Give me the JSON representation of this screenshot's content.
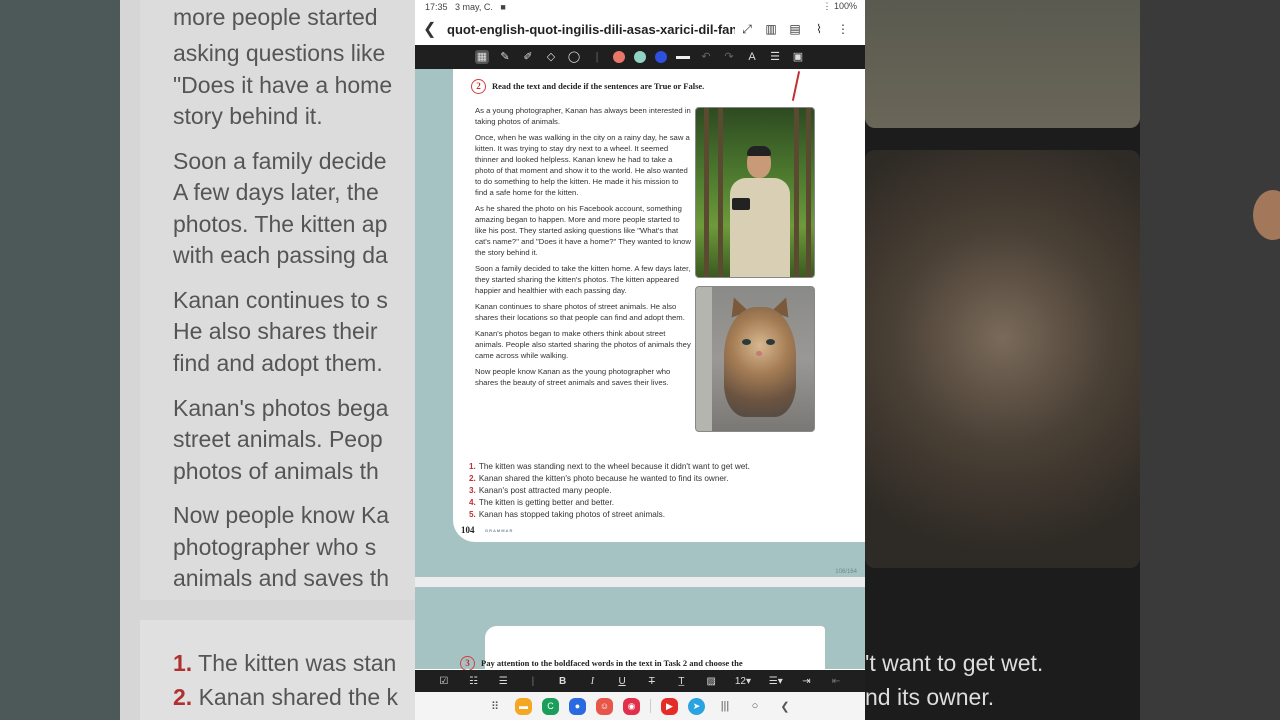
{
  "status": {
    "time": "17:35",
    "date": "3 may, C.",
    "battery": "100%"
  },
  "app": {
    "title": "quot-english-quot-ingilis-dili-asas-xarici-dil-fan",
    "back_icon": "arrow-left-icon",
    "toolbar_icons": [
      "expand-icon",
      "book-icon",
      "reader-icon",
      "attach-icon",
      "more-icon"
    ]
  },
  "pen_toolbar": {
    "tools": [
      "keyboard-icon",
      "pen-icon",
      "highlighter-icon",
      "eraser-icon",
      "lasso-icon"
    ],
    "colors": [
      "#e8776a",
      "#8fd3c2",
      "#2e4fe0"
    ]
  },
  "task": {
    "number": "2",
    "heading": "Read the text and decide if the sentences are True or False.",
    "paragraphs": [
      "As a young photographer, Kanan has always been interested in taking photos of animals.",
      "Once, when he was walking in the city on a rainy day, he saw a kitten. It was trying to stay dry next to a wheel. It seemed thinner and looked helpless. Kanan knew he had to take a photo of that moment and show it to the world. He also wanted to do something to help the kitten. He made it his mission to find a safe home for the kitten.",
      "As he shared the photo on his Facebook account, something amazing began to happen. More and more people started to like his post. They started asking questions like \"What's that cat's name?\" and \"Does it have a home?\" They wanted to know the story behind it.",
      "Soon a family decided to take the kitten home. A few days later, they started sharing the kitten's photos. The kitten appeared happier and healthier with each passing day.",
      "Kanan continues to share photos of street animals. He also shares their locations so that people can find and adopt them.",
      "Kanan's photos began to make others think about street animals. People also started sharing the photos of animals they came across while walking.",
      "Now people know Kanan as the young photographer who shares the beauty of street animals and saves their lives."
    ],
    "statements": [
      {
        "n": "1.",
        "text": "The kitten was standing next to the wheel because it didn't want to get wet."
      },
      {
        "n": "2.",
        "text": "Kanan shared the kitten's photo because he wanted to find its owner."
      },
      {
        "n": "3.",
        "text": "Kanan's post attracted many people."
      },
      {
        "n": "4.",
        "text": "The kitten is getting better and better."
      },
      {
        "n": "5.",
        "text": "Kanan has stopped taking photos of street animals."
      }
    ]
  },
  "page": {
    "number": "104",
    "label": "GRAMMAR",
    "count": "106/164"
  },
  "next_task": {
    "number": "3",
    "heading": "Pay attention to the boldfaced words in the text in Task 2 and choose the"
  },
  "format_toolbar": {
    "bold": "B",
    "italic": "I",
    "underline": "U",
    "strike": "T",
    "font_size": "12"
  },
  "background_left": {
    "lines": [
      "more people started",
      "asking questions like",
      "\"Does it have a home",
      "story behind it.",
      "Soon a family decide",
      "A few days later, the",
      "photos. The kitten ap",
      "with each passing da",
      "Kanan continues to s",
      "He also shares their",
      "find and adopt them.",
      "Kanan's photos bega",
      "street animals. Peop",
      "photos of animals th",
      "Now people know Ka",
      "photographer who s",
      "animals and saves th"
    ],
    "statements": [
      {
        "n": "1.",
        "text": "The kitten was stan"
      },
      {
        "n": "2.",
        "text": "Kanan shared the k"
      }
    ]
  },
  "background_right": {
    "lines": [
      "'t want to get wet.",
      "nd its owner."
    ]
  }
}
